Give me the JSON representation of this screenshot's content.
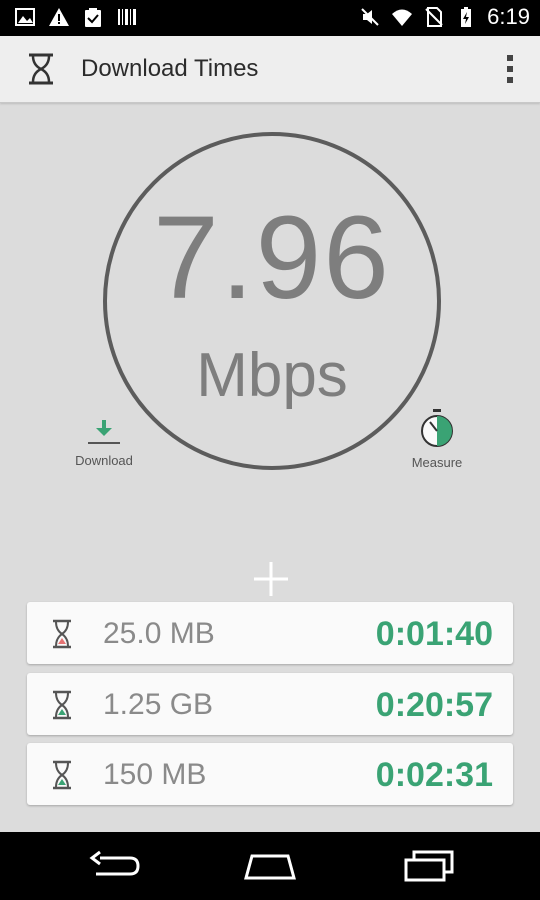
{
  "status_bar": {
    "time": "6:19",
    "left_icons": [
      "image-icon",
      "warning-icon",
      "clipboard-icon",
      "barcode-icon"
    ],
    "right_icons": [
      "mute-icon",
      "wifi-icon",
      "no-sim-icon",
      "battery-charging-icon"
    ]
  },
  "app_bar": {
    "title": "Download Times",
    "logo_icon": "hourglass-icon",
    "menu_icon": "overflow-menu-icon"
  },
  "gauge": {
    "value": "7.96",
    "unit": "Mbps"
  },
  "actions": {
    "download_label": "Download",
    "measure_label": "Measure"
  },
  "add_icon": "plus-icon",
  "items": [
    {
      "size": "25.0 MB",
      "time": "0:01:40",
      "icon_color": "#e57373"
    },
    {
      "size": "1.25 GB",
      "time": "0:20:57",
      "icon_color": "#3aa374"
    },
    {
      "size": "150 MB",
      "time": "0:02:31",
      "icon_color": "#3aa374"
    }
  ],
  "colors": {
    "accent": "#3aa374",
    "background": "#dcdcdc"
  },
  "nav_bar": {
    "icons": [
      "back-icon",
      "home-icon",
      "recent-apps-icon"
    ]
  }
}
